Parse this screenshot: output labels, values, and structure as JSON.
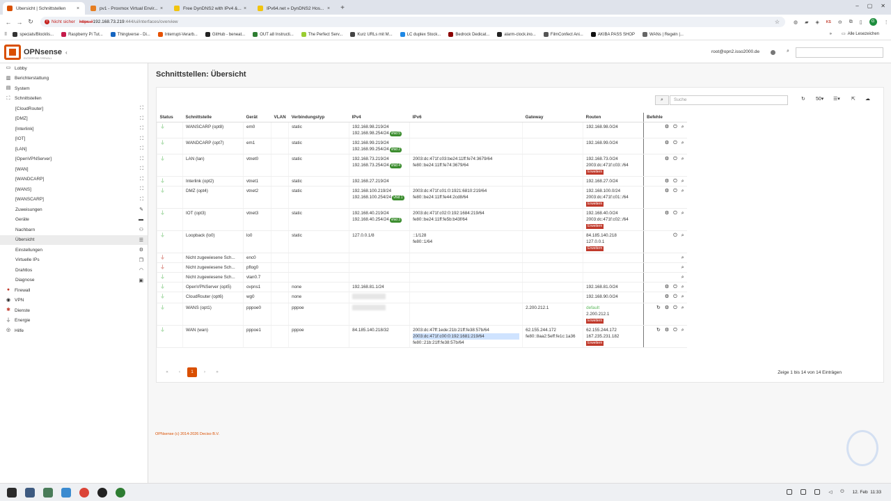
{
  "browser": {
    "tabs": [
      {
        "title": "Übersicht | Schnittstellen",
        "active": true,
        "color": "#d94f00"
      },
      {
        "title": "pv1 - Proxmox Virtual Envir...",
        "active": false,
        "color": "#e67e22"
      },
      {
        "title": "Free DynDNS2 with IPv4 &...",
        "active": false,
        "color": "#f1c40f"
      },
      {
        "title": "IPv64.net » DynDNS2 Hos...",
        "active": false,
        "color": "#f1c40f"
      }
    ],
    "security_label": "Nicht sicher",
    "url_scheme": "https://",
    "url_host": "192.168.73.219",
    "url_path": ":444/ui/interfaces/overview",
    "bookmarks": [
      "specials/Blocklis...",
      "Raspberry Pi Tut...",
      "Thingiverse - Di...",
      "Interrupt-Verarb...",
      "GitHub - beneat...",
      "OUT a8 Instructi...",
      "The Perfect Serv...",
      "Kurz URLs mit M...",
      "LC duplex Stock...",
      "Bedrock Dedicat...",
      "alarm-clock.ino...",
      "FilmConfect Ani...",
      "AKIBA PASS SHOP",
      "WANs | Regeln |..."
    ],
    "all_bookmarks": "Alle Lesezeichen",
    "ext_label": "KS",
    "profile": "G"
  },
  "header": {
    "brand": "OPNsense",
    "brand_sub": "ENTERPRISE FIREWALL",
    "user": "root@opn2.isso2000.de"
  },
  "sidebar": {
    "items": [
      {
        "label": "Lobby",
        "level": "top",
        "icon": "laptop-icon",
        "glyph": "▭"
      },
      {
        "label": "Berichterstattung",
        "level": "top",
        "icon": "chart-icon",
        "glyph": "▥"
      },
      {
        "label": "System",
        "level": "top",
        "icon": "server-icon",
        "glyph": "▤"
      },
      {
        "label": "Schnittstellen",
        "level": "top",
        "icon": "sitemap-icon",
        "glyph": "⛶"
      },
      {
        "label": "[CloudRouter]",
        "level": "sub",
        "right": "sitemap-icon",
        "rglyph": "⛶"
      },
      {
        "label": "[DMZ]",
        "level": "sub",
        "right": "sitemap-icon",
        "rglyph": "⛶"
      },
      {
        "label": "[Interlink]",
        "level": "sub",
        "right": "sitemap-icon",
        "rglyph": "⛶"
      },
      {
        "label": "[IOT]",
        "level": "sub",
        "right": "sitemap-icon",
        "rglyph": "⛶"
      },
      {
        "label": "[LAN]",
        "level": "sub",
        "right": "sitemap-icon",
        "rglyph": "⛶"
      },
      {
        "label": "[OpenVPNServer]",
        "level": "sub",
        "right": "sitemap-icon",
        "rglyph": "⛶"
      },
      {
        "label": "[WAN]",
        "level": "sub",
        "right": "sitemap-icon",
        "rglyph": "⛶"
      },
      {
        "label": "[WANDCARP]",
        "level": "sub",
        "right": "sitemap-icon",
        "rglyph": "⛶"
      },
      {
        "label": "[WANS]",
        "level": "sub",
        "right": "sitemap-icon",
        "rglyph": "⛶"
      },
      {
        "label": "[WANSCARP]",
        "level": "sub",
        "right": "sitemap-icon",
        "rglyph": "⛶"
      },
      {
        "label": "Zuweisungen",
        "level": "sub",
        "right": "pencil-icon",
        "rglyph": "✎"
      },
      {
        "label": "Geräte",
        "level": "sub",
        "right": "hdd-icon",
        "rglyph": "▬"
      },
      {
        "label": "Nachbarn",
        "level": "sub",
        "right": "users-icon",
        "rglyph": "⚇"
      },
      {
        "label": "Übersicht",
        "level": "sub",
        "right": "tasks-icon",
        "rglyph": "☰",
        "active": true
      },
      {
        "label": "Einstellungen",
        "level": "sub",
        "right": "cogs-icon",
        "rglyph": "⚙"
      },
      {
        "label": "Virtuelle IPs",
        "level": "sub",
        "right": "clone-icon",
        "rglyph": "❐"
      },
      {
        "label": "Drahtlos",
        "level": "sub",
        "right": "wifi-icon",
        "rglyph": "◠"
      },
      {
        "label": "Diagnose",
        "level": "sub",
        "right": "medkit-icon",
        "rglyph": "▣"
      },
      {
        "label": "Firewall",
        "level": "top",
        "icon": "fire-icon",
        "glyph": "●",
        "cls": "fw"
      },
      {
        "label": "VPN",
        "level": "top",
        "icon": "globe-icon",
        "glyph": "◉",
        "cls": "vpn"
      },
      {
        "label": "Dienste",
        "level": "top",
        "icon": "cog-icon",
        "glyph": "✱",
        "cls": "dienste"
      },
      {
        "label": "Energie",
        "level": "top",
        "icon": "plug-icon",
        "glyph": "⏚",
        "cls": "energie"
      },
      {
        "label": "Hilfe",
        "level": "top",
        "icon": "lifebuoy-icon",
        "glyph": "◎",
        "cls": "hilfe"
      }
    ]
  },
  "main": {
    "title": "Schnittstellen: Übersicht",
    "search_placeholder": "Suche",
    "page_size": "50",
    "columns": [
      "Status",
      "Schnittstelle",
      "Gerät",
      "VLAN",
      "Verbindungstyp",
      "IPv4",
      "IPv6",
      "Gateway",
      "Routen",
      "Befehle"
    ],
    "expand_label": "Erweitern",
    "rows": [
      {
        "up": true,
        "name": "WANSCARP (opt8)",
        "device": "em0",
        "vlan": "",
        "type": "static",
        "ipv4": [
          "192.168.98.219/24",
          "192.168.98.254/24"
        ],
        "vhid": "vhid 5",
        "ipv6": [],
        "gateway": [],
        "routes": [
          "192.168.98.0/24"
        ],
        "expand": false,
        "cmds": [
          "cog",
          "power",
          "search"
        ]
      },
      {
        "up": true,
        "name": "WANDCARP (opt7)",
        "device": "em1",
        "vlan": "",
        "type": "static",
        "ipv4": [
          "192.168.99.219/24",
          "192.168.99.254/24"
        ],
        "vhid": "vhid 2",
        "ipv6": [],
        "gateway": [],
        "routes": [
          "192.168.99.0/24"
        ],
        "expand": false,
        "cmds": [
          "cog",
          "power",
          "search"
        ]
      },
      {
        "up": true,
        "name": "LAN (lan)",
        "device": "vtnet0",
        "vlan": "",
        "type": "static",
        "ipv4": [
          "192.168.73.219/24",
          "192.168.73.254/24"
        ],
        "vhid": "vhid 4",
        "ipv6": [
          "2003:dc:471f:c03:be24:11ff:fe74:3679/64",
          "fe80::be24:11ff:fe74:3679/64"
        ],
        "gateway": [],
        "routes": [
          "192.168.73.0/24",
          "2003:dc:471f:c03::/64"
        ],
        "expand": true,
        "cmds": [
          "cog",
          "power",
          "search"
        ]
      },
      {
        "up": true,
        "name": "Interlink (opt2)",
        "device": "vtnet1",
        "vlan": "",
        "type": "static",
        "ipv4": [
          "192.168.27.219/24"
        ],
        "vhid": "",
        "ipv6": [],
        "gateway": [],
        "routes": [
          "192.168.27.0/24"
        ],
        "expand": false,
        "cmds": [
          "cog",
          "power",
          "search"
        ]
      },
      {
        "up": true,
        "name": "DMZ (opt4)",
        "device": "vtnet2",
        "vlan": "",
        "type": "static",
        "ipv4": [
          "192.168.100.219/24",
          "192.168.100.254/24"
        ],
        "vhid": "vhid 1",
        "ipv6": [
          "2003:dc:471f:c01:0:1921:6810:219/64",
          "fe80::be24:11ff:fe44:2cd8/64"
        ],
        "gateway": [],
        "routes": [
          "192.168.100.0/24",
          "2003:dc:471f:c01::/64"
        ],
        "expand": true,
        "cmds": [
          "cog",
          "power",
          "search"
        ]
      },
      {
        "up": true,
        "name": "IOT (opt3)",
        "device": "vtnet3",
        "vlan": "",
        "type": "static",
        "ipv4": [
          "192.168.40.219/24",
          "192.168.40.254/24"
        ],
        "vhid": "vhid 3",
        "ipv6": [
          "2003:dc:471f:c02:0:192:1684:219/64",
          "fe80::be24:11ff:fe5b:b43f/64"
        ],
        "gateway": [],
        "routes": [
          "192.168.40.0/24",
          "2003:dc:471f:c02::/64"
        ],
        "expand": true,
        "cmds": [
          "cog",
          "power",
          "search"
        ]
      },
      {
        "up": true,
        "name": "Loopback (lo0)",
        "device": "lo0",
        "vlan": "",
        "type": "static",
        "ipv4": [
          "127.0.0.1/8"
        ],
        "vhid": "",
        "ipv6": [
          "::1/128",
          "fe80::1/64"
        ],
        "gateway": [],
        "routes": [
          "84.185.140.218",
          "127.0.0.1"
        ],
        "expand": true,
        "cmds": [
          "power",
          "search"
        ]
      },
      {
        "up": false,
        "name": "Nicht zugewiesene Sch...",
        "device": "enc0",
        "vlan": "",
        "type": "",
        "ipv4": [],
        "vhid": "",
        "ipv6": [],
        "gateway": [],
        "routes": [],
        "expand": false,
        "cmds": [
          "search"
        ]
      },
      {
        "up": false,
        "name": "Nicht zugewiesene Sch...",
        "device": "pflog0",
        "vlan": "",
        "type": "",
        "ipv4": [],
        "vhid": "",
        "ipv6": [],
        "gateway": [],
        "routes": [],
        "expand": false,
        "cmds": [
          "search"
        ]
      },
      {
        "up": true,
        "name": "Nicht zugewiesene Sch...",
        "device": "vlan0.7",
        "vlan": "",
        "type": "",
        "ipv4": [],
        "vhid": "",
        "ipv6": [],
        "gateway": [],
        "routes": [],
        "expand": false,
        "cmds": [
          "search"
        ]
      },
      {
        "up": true,
        "name": "OpenVPNServer (opt5)",
        "device": "ovpns1",
        "vlan": "",
        "type": "none",
        "ipv4": [
          "192.168.81.1/24"
        ],
        "vhid": "",
        "ipv6": [],
        "gateway": [],
        "routes": [
          "192.168.81.0/24"
        ],
        "expand": false,
        "cmds": [
          "cog",
          "power",
          "search"
        ]
      },
      {
        "up": true,
        "name": "CloudRouter (opt6)",
        "device": "wg0",
        "vlan": "",
        "type": "none",
        "ipv4": [],
        "blur": true,
        "vhid": "",
        "ipv6": [],
        "gateway": [],
        "routes": [
          "192.168.90.0/24"
        ],
        "expand": false,
        "cmds": [
          "cog",
          "power",
          "search"
        ]
      },
      {
        "up": true,
        "name": "WANS (opt1)",
        "device": "pppoe0",
        "vlan": "",
        "type": "pppoe",
        "ipv4": [],
        "blur": true,
        "vhid": "",
        "ipv6": [],
        "gateway": [
          "2.200.212.1"
        ],
        "routes": [
          "default",
          "2.200.212.1"
        ],
        "expand": true,
        "cmds": [
          "reload",
          "cog",
          "power",
          "search"
        ]
      },
      {
        "up": true,
        "name": "WAN (wan)",
        "device": "pppoe1",
        "vlan": "",
        "type": "pppoe",
        "ipv4": [
          "84.185.140.218/32"
        ],
        "vhid": "",
        "ipv6": [
          "2003:dc:47ff:1ede:21b:21ff:fe38:57b/64",
          "2003:dc:471f:c00:0:192:1681:219/64",
          "fe80::21b:21ff:fe38:57b/64"
        ],
        "gateway": [
          "62.155.244.172",
          "fe80::8aa2:5eff:fe1c:1a36"
        ],
        "routes": [
          "62.155.244.172",
          "167.235.231.182"
        ],
        "expand": true,
        "cmds": [
          "reload",
          "cog",
          "power",
          "search"
        ]
      }
    ],
    "pager": {
      "current": "1",
      "summary": "Zeige 1 bis 14 von 14 Einträgen"
    },
    "copyright": "OPNsense (c) 2014-2026 Deciso B.V."
  },
  "taskbar": {
    "date": "12. Feb",
    "time": "11:33"
  }
}
